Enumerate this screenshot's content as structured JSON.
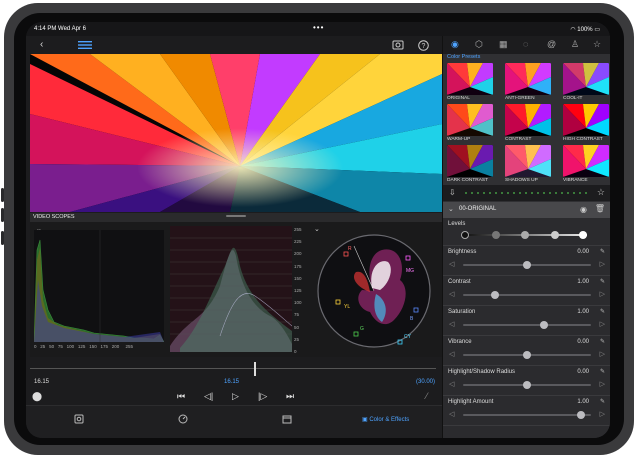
{
  "status": {
    "time": "4:14 PM  Wed Apr 6",
    "battery": "100%"
  },
  "toolbar": {
    "back_icon": "back-icon",
    "list_icon": "adjust-list-icon",
    "compare_icon": "compare-icon",
    "info_icon": "info-icon"
  },
  "scopes": {
    "label": "VIDEO SCOPES",
    "histogram_ticks": [
      "0",
      "25",
      "50",
      "75",
      "100",
      "125",
      "150",
      "175",
      "200",
      "255"
    ],
    "waveform_ticks": [
      "255",
      "225",
      "200",
      "175",
      "150",
      "125",
      "100",
      "75",
      "50",
      "25",
      "0"
    ],
    "vector_labels": [
      "R",
      "MG",
      "YL",
      "B",
      "G",
      "CY"
    ]
  },
  "timeline": {
    "time_left": "16.15",
    "time_mid": "16.15",
    "time_right": "(30.00)",
    "tab_label": "Color & Effects"
  },
  "panel": {
    "presets_title": "Color Presets",
    "presets": [
      "ORIGINAL",
      "ANTI-GREEN",
      "COOL-IT",
      "WARM-UP",
      "CONTRAST",
      "HIGH CONTRAST",
      "DARK CONTRAST",
      "SHADOWS UP",
      "VIBRANCE"
    ],
    "selected_preset": "00-ORIGINAL",
    "levels_label": "Levels",
    "adjustments": [
      {
        "name": "Brightness",
        "value": "0.00",
        "level": 0.5
      },
      {
        "name": "Contrast",
        "value": "1.00",
        "level": 0.25
      },
      {
        "name": "Saturation",
        "value": "1.00",
        "level": 0.63
      },
      {
        "name": "Vibrance",
        "value": "0.00",
        "level": 0.5
      },
      {
        "name": "Highlight/Shadow Radius",
        "value": "0.00",
        "level": 0.5
      },
      {
        "name": "Highlight Amount",
        "value": "1.00",
        "level": 0.92
      }
    ]
  },
  "colors": {
    "accent": "#4ea3ff",
    "background": "#1c1c1e",
    "panel": "#303033"
  }
}
